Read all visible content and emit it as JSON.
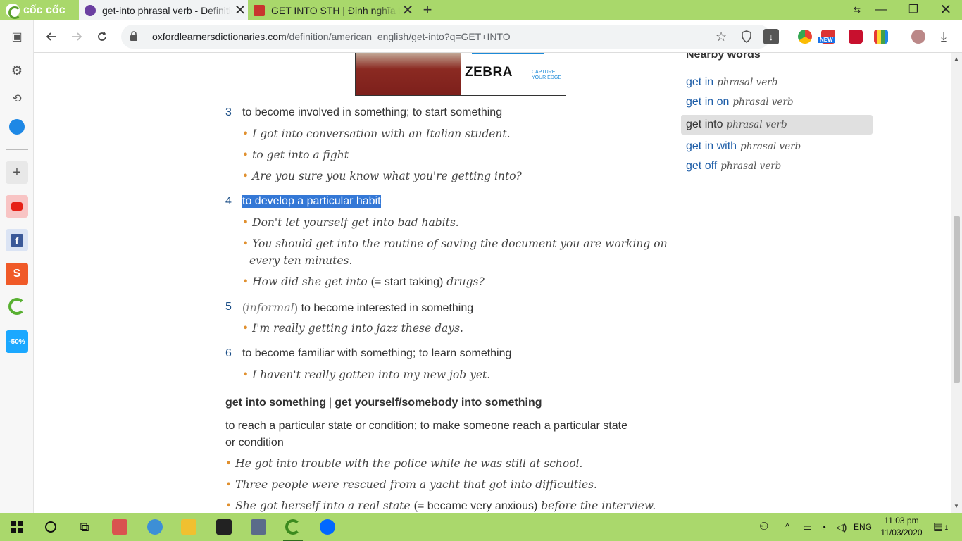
{
  "browser": {
    "brand": "cốc cốc",
    "tabs": [
      {
        "title": "get-into phrasal verb - Definition",
        "favicon_color": "#6b3fa0"
      },
      {
        "title": "GET INTO STH | Định nghĩa trong",
        "favicon_color": "#c8352e"
      }
    ],
    "new_tab_icon": "+",
    "url_domain": "oxfordlearnersdictionaries.com",
    "url_path": "/definition/american_english/get-into?q=GET+INTO",
    "ext_badge": "NEW"
  },
  "ad": {
    "brand": "ZEBRA",
    "tagline_1": "CAPTURE",
    "tagline_2": "YOUR EDGE"
  },
  "senses": [
    {
      "num": "3",
      "def": "to become involved in something; to start something",
      "examples": [
        "I got into conversation with an Italian student.",
        "to get into a fight",
        "Are you sure you know what you're getting into?"
      ]
    },
    {
      "num": "4",
      "def": "to develop a particular habit",
      "examples": [
        "Don't let yourself get into bad habits.",
        "You should get into the routine of saving the document you are working on",
        "every ten minutes.",
        "How did she get into",
        "(= start taking)",
        "drugs?"
      ]
    },
    {
      "num": "5",
      "label_open": "(",
      "label": "informal",
      "label_close": ")",
      "def": "to become interested in something",
      "examples": [
        "I'm really getting into jazz these days."
      ]
    },
    {
      "num": "6",
      "def": "to become familiar with something; to learn something",
      "examples": [
        "I haven't really gotten into my new job yet."
      ]
    }
  ],
  "idiom": {
    "head_1": "get into something",
    "separator": "|",
    "head_2": "get yourself/somebody into something",
    "def_line_1": "to reach a particular state or condition; to make someone reach a particular state",
    "def_line_2": "or condition",
    "examples": [
      "He got into trouble with the police while he was still at school.",
      "Three people were rescued from a yacht that got into difficulties.",
      "She got herself into a real state",
      "(= became very anxious)",
      "before the interview."
    ]
  },
  "nearby": {
    "title": "Nearby words",
    "items": [
      {
        "word": "get in",
        "pos": "phrasal verb"
      },
      {
        "word": "get in on",
        "pos": "phrasal verb"
      },
      {
        "word": "get into",
        "pos": "phrasal verb"
      },
      {
        "word": "get in with",
        "pos": "phrasal verb"
      },
      {
        "word": "get off",
        "pos": "phrasal verb"
      }
    ]
  },
  "taskbar": {
    "lang": "ENG",
    "time": "11:03 pm",
    "date": "11/03/2020",
    "notif_count": "1"
  },
  "colors": {
    "accent_green": "#a9d86b",
    "link_blue": "#1f5ea8",
    "highlight": "#3478d6",
    "bullet_orange": "#e0902f"
  }
}
